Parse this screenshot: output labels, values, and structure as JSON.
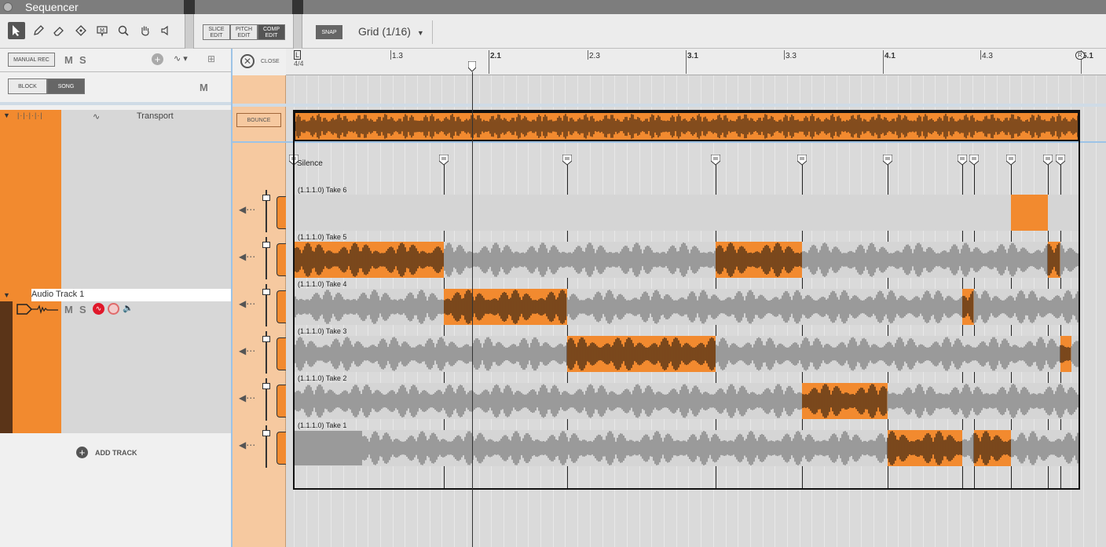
{
  "window": {
    "title": "Sequencer"
  },
  "toolbar": {
    "tools": [
      "arrow-tool",
      "pencil-tool",
      "eraser-tool",
      "stamp-tool",
      "marker-tool",
      "zoom-tool",
      "hand-tool",
      "speaker-tool"
    ],
    "slice_edit": "SLICE EDIT",
    "pitch_edit": "PITCH EDIT",
    "comp_edit": "COMP EDIT",
    "snap": "SNAP",
    "grid": "Grid (1/16)"
  },
  "left": {
    "manual_rec": "MANUAL REC",
    "m": "M",
    "s": "S",
    "block": "BLOCK",
    "song": "SONG",
    "m2": "M",
    "transport_label": "Transport",
    "track_name": "Audio Track 1",
    "add_track": "ADD TRACK"
  },
  "lanecol": {
    "close": "CLOSE",
    "bounce": "BOUNCE"
  },
  "ruler": {
    "time_sig": "4/4",
    "marks": [
      "1.3",
      "2.1",
      "2.3",
      "3.1",
      "3.3",
      "4.1",
      "4.3",
      "5.1"
    ]
  },
  "comp": {
    "silence": "Silence",
    "takes": [
      "(1.1.1.0) Take 6",
      "(1.1.1.0) Take 5",
      "(1.1.1.0) Take 4",
      "(1.1.1.0) Take 3",
      "(1.1.1.0) Take 2",
      "(1.1.1.0) Take 1"
    ]
  },
  "colors": {
    "accent": "#f28a2f",
    "dark_wave": "#3a2412",
    "wave": "#7a7a7a"
  }
}
